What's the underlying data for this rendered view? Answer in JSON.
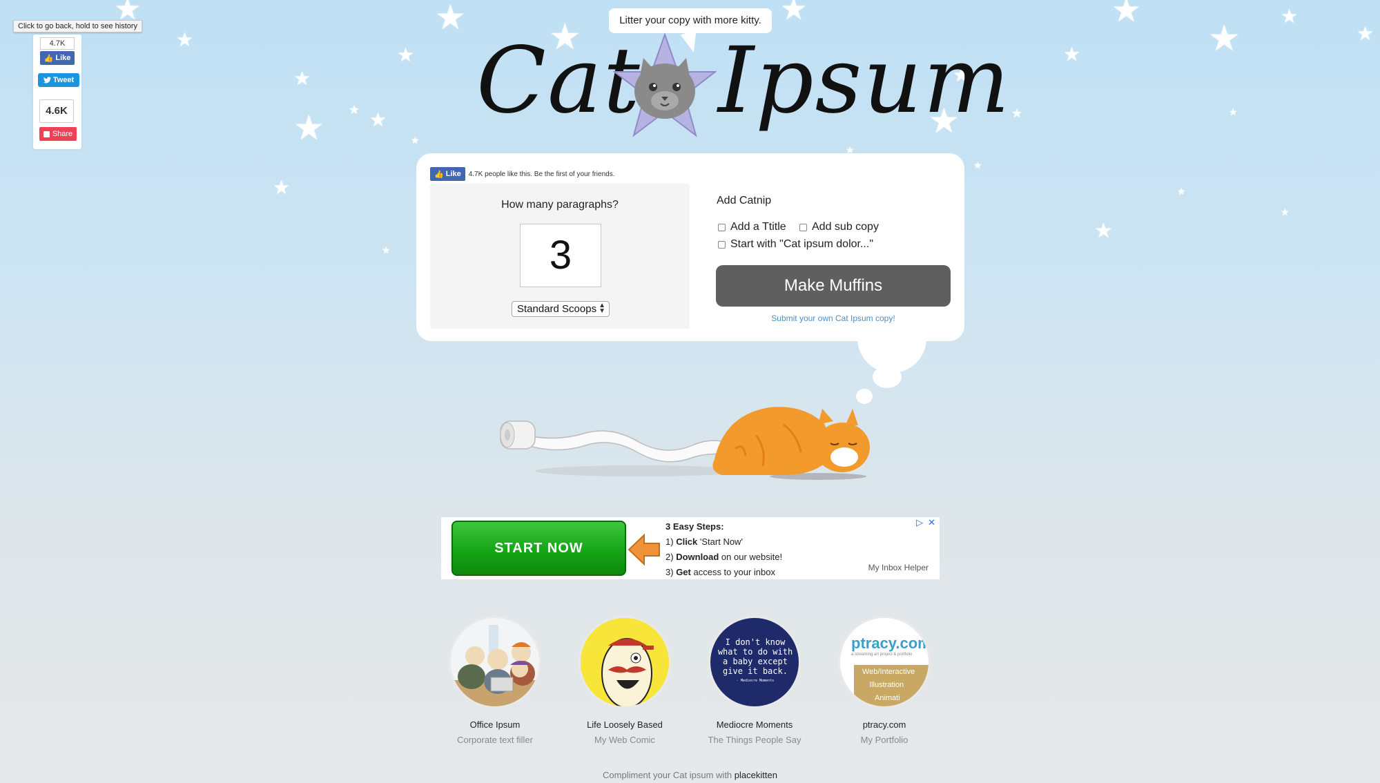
{
  "tooltip": "Click to go back, hold to see history",
  "social": {
    "fb_count": "4.7K",
    "fb_like": "Like",
    "tweet": "Tweet",
    "share_count": "4.6K",
    "share": "Share"
  },
  "header": {
    "tagline": "Litter your copy with more kitty.",
    "logo_left": "Cat",
    "logo_right": "Ipsum"
  },
  "card": {
    "fb_like": "Like",
    "fb_text": "4.7K people like this. Be the first of your friends.",
    "paragraphs_label": "How many paragraphs?",
    "paragraphs_value": "3",
    "scoop_select": "Standard Scoops",
    "catnip_title": "Add Catnip",
    "options": {
      "title": "Add a Ttitle",
      "subcopy": "Add sub copy",
      "start": "Start with \"Cat ipsum dolor...\""
    },
    "button": "Make Muffins",
    "submit_link": "Submit your own Cat Ipsum copy!"
  },
  "ad": {
    "button": "START NOW",
    "steps_head": "3 Easy Steps:",
    "step1_num": "1)",
    "step1_bold": "Click",
    "step1_rest": "'Start Now'",
    "step2_num": "2)",
    "step2_bold": "Download",
    "step2_rest": "on our website!",
    "step3_num": "3)",
    "step3_bold": "Get",
    "step3_rest": "access to your inbox",
    "brand": "My Inbox Helper"
  },
  "portfolio": [
    {
      "name": "Office Ipsum",
      "sub": "Corporate text filler"
    },
    {
      "name": "Life Loosely Based",
      "sub": "My Web Comic"
    },
    {
      "name": "Mediocre Moments",
      "sub": "The Things People Say",
      "image_text": "I don't know what to do with a baby except give it back.",
      "image_credit": "- Mediocre Moments"
    },
    {
      "name": "ptracy.com",
      "sub": "My Portfolio",
      "image_title": "ptracy.com",
      "image_tagline": "a streaming art project & portfolio",
      "image_lines": [
        "Web/Interactive",
        "Illustration",
        "Animati"
      ]
    }
  ],
  "footer": {
    "text": "Compliment your Cat ipsum with",
    "link": "placekitten"
  },
  "colors": {
    "fb_blue": "#4267b2",
    "twitter_blue": "#1b95e0",
    "share_red": "#ee4056",
    "button_gray": "#5f5f5f",
    "ad_green": "#17a417",
    "cat_orange": "#f39a2c"
  }
}
